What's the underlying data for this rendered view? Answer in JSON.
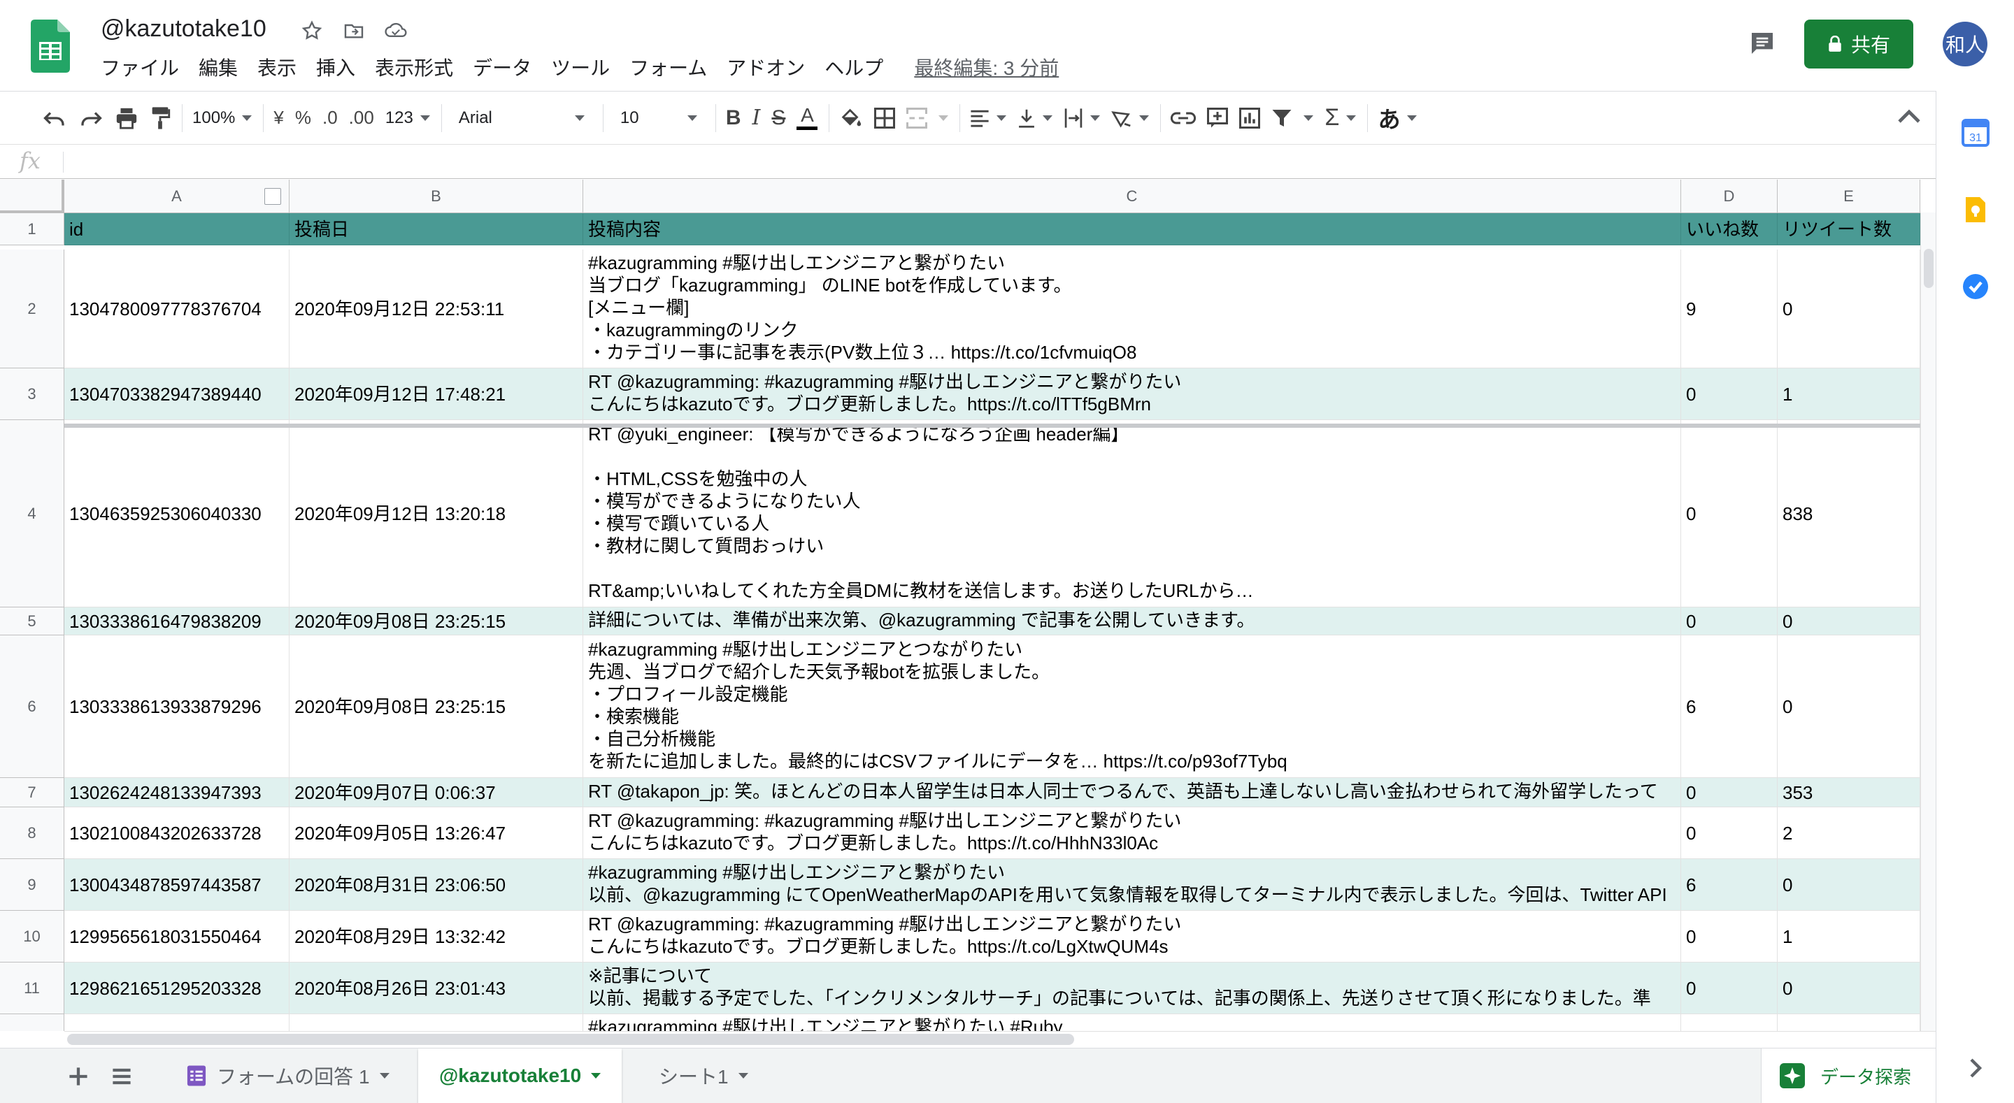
{
  "doc": {
    "title": "@kazutotake10",
    "last_edit": "最終編集: 3 分前",
    "share_label": "共有",
    "avatar_text": "和人"
  },
  "menu": [
    "ファイル",
    "編集",
    "表示",
    "挿入",
    "表示形式",
    "データ",
    "ツール",
    "フォーム",
    "アドオン",
    "ヘルプ"
  ],
  "toolbar": {
    "zoom": "100%",
    "currency": "¥",
    "percent": "%",
    "dec_decrease": ".0",
    "dec_increase": ".00",
    "more_formats": "123",
    "font": "Arial",
    "font_size": "10",
    "bold": "B",
    "italic": "I",
    "strike": "S",
    "text_color": "A",
    "input_tools": "あ"
  },
  "formula_bar": {
    "fx": "fx",
    "value": ""
  },
  "grid": {
    "columns": [
      "A",
      "B",
      "C",
      "D",
      "E"
    ],
    "header_color": "#4a9a94",
    "band_color": "#e0f1ef",
    "header_row": [
      "id",
      "投稿日",
      "投稿内容",
      "いいね数",
      "リツイート数"
    ],
    "rows": [
      {
        "num": "2",
        "id": "1304780097778376704",
        "date": "2020年09月12日 22:53:11",
        "content": "#kazugramming #駆け出しエンジニアと繋がりたい\n当ブログ「kazugramming」 のLINE botを作成しています。\n[メニュー欄]\n・kazugrammingのリンク\n・カテゴリー事に記事を表示(PV数上位３… https://t.co/1cfvmuiqO8",
        "likes": "9",
        "retweets": "0"
      },
      {
        "num": "3",
        "id": "1304703382947389440",
        "date": "2020年09月12日 17:48:21",
        "content": "RT @kazugramming: #kazugramming #駆け出しエンジニアと繋がりたい\nこんにちはkazutoです。ブログ更新しました。https://t.co/lTTf5gBMrn",
        "likes": "0",
        "retweets": "1"
      },
      {
        "num": "4",
        "id": "1304635925306040330",
        "date": "2020年09月12日 13:20:18",
        "content": "RT @yuki_engineer: 【模写ができるようになろう企画 header編】\n\n・HTML,CSSを勉強中の人\n・模写ができるようになりたい人\n・模写で躓いている人\n・教材に関して質問おっけい\n\nRT&amp;いいねしてくれた方全員DMに教材を送信します。お送りしたURLから…",
        "likes": "0",
        "retweets": "838"
      },
      {
        "num": "5",
        "id": "1303338616479838209",
        "date": "2020年09月08日 23:25:15",
        "content": "詳細については、準備が出来次第、@kazugramming で記事を公開していきます。",
        "likes": "0",
        "retweets": "0"
      },
      {
        "num": "6",
        "id": "1303338613933879296",
        "date": "2020年09月08日 23:25:15",
        "content": "#kazugramming #駆け出しエンジニアとつながりたい\n先週、当ブログで紹介した天気予報botを拡張しました。\n・プロフィール設定機能\n・検索機能\n・自己分析機能\nを新たに追加しました。最終的にはCSVファイルにデータを… https://t.co/p93of7Tybq",
        "likes": "6",
        "retweets": "0"
      },
      {
        "num": "7",
        "id": "1302624248133947393",
        "date": "2020年09月07日 0:06:37",
        "content": "RT @takapon_jp: 笑。ほとんどの日本人留学生は日本人同士でつるんで、英語も上達しないし高い金払わせられて海外留学したって",
        "likes": "0",
        "retweets": "353"
      },
      {
        "num": "8",
        "id": "1302100843202633728",
        "date": "2020年09月05日 13:26:47",
        "content": "RT @kazugramming: #kazugramming #駆け出しエンジニアと繋がりたい\nこんにちはkazutoです。ブログ更新しました。https://t.co/HhhN33l0Ac",
        "likes": "0",
        "retweets": "2"
      },
      {
        "num": "9",
        "id": "1300434878597443587",
        "date": "2020年08月31日 23:06:50",
        "content": "#kazugramming #駆け出しエンジニアと繋がりたい\n以前、@kazugramming にてOpenWeatherMapのAPIを用いて気象情報を取得してターミナル内で表示しました。今回は、Twitter API",
        "likes": "6",
        "retweets": "0"
      },
      {
        "num": "10",
        "id": "1299565618031550464",
        "date": "2020年08月29日 13:32:42",
        "content": "RT @kazugramming: #kazugramming #駆け出しエンジニアと繋がりたい\nこんにちはkazutoです。ブログ更新しました。https://t.co/LgXtwQUM4s",
        "likes": "0",
        "retweets": "1"
      },
      {
        "num": "11",
        "id": "1298621651295203328",
        "date": "2020年08月26日 23:01:43",
        "content": "※記事について\n以前、掲載する予定でした、「インクリメンタルサーチ」の記事については、記事の関係上、先送りさせて頂く形になりました。準",
        "likes": "0",
        "retweets": "0"
      },
      {
        "num": "",
        "id": "",
        "date": "",
        "content": "#kazugramming #駆け出しエンジニアと繋がりたい #Ruby",
        "likes": "",
        "retweets": ""
      }
    ]
  },
  "sheets": {
    "tabs": [
      {
        "label": "フォームの回答 1",
        "active": false
      },
      {
        "label": "@kazutotake10",
        "active": true
      },
      {
        "label": "シート1",
        "active": false
      }
    ],
    "explore_label": "データ探索"
  },
  "icons": {
    "undo": "undo-icon",
    "redo": "redo-icon",
    "print": "print-icon",
    "paint_format": "paint-format-icon",
    "fill_color": "fill-color-icon",
    "borders": "borders-icon",
    "merge": "merge-cells-icon",
    "align": "horizontal-align-icon",
    "valign": "vertical-align-icon",
    "wrap": "text-wrap-icon",
    "rotate": "text-rotate-icon",
    "link": "insert-link-icon",
    "comment": "insert-comment-icon",
    "chart": "insert-chart-icon",
    "filter": "filter-icon",
    "functions": "functions-icon"
  },
  "colors": {
    "share_green": "#188038",
    "avatar_blue": "#3b5fa8"
  }
}
